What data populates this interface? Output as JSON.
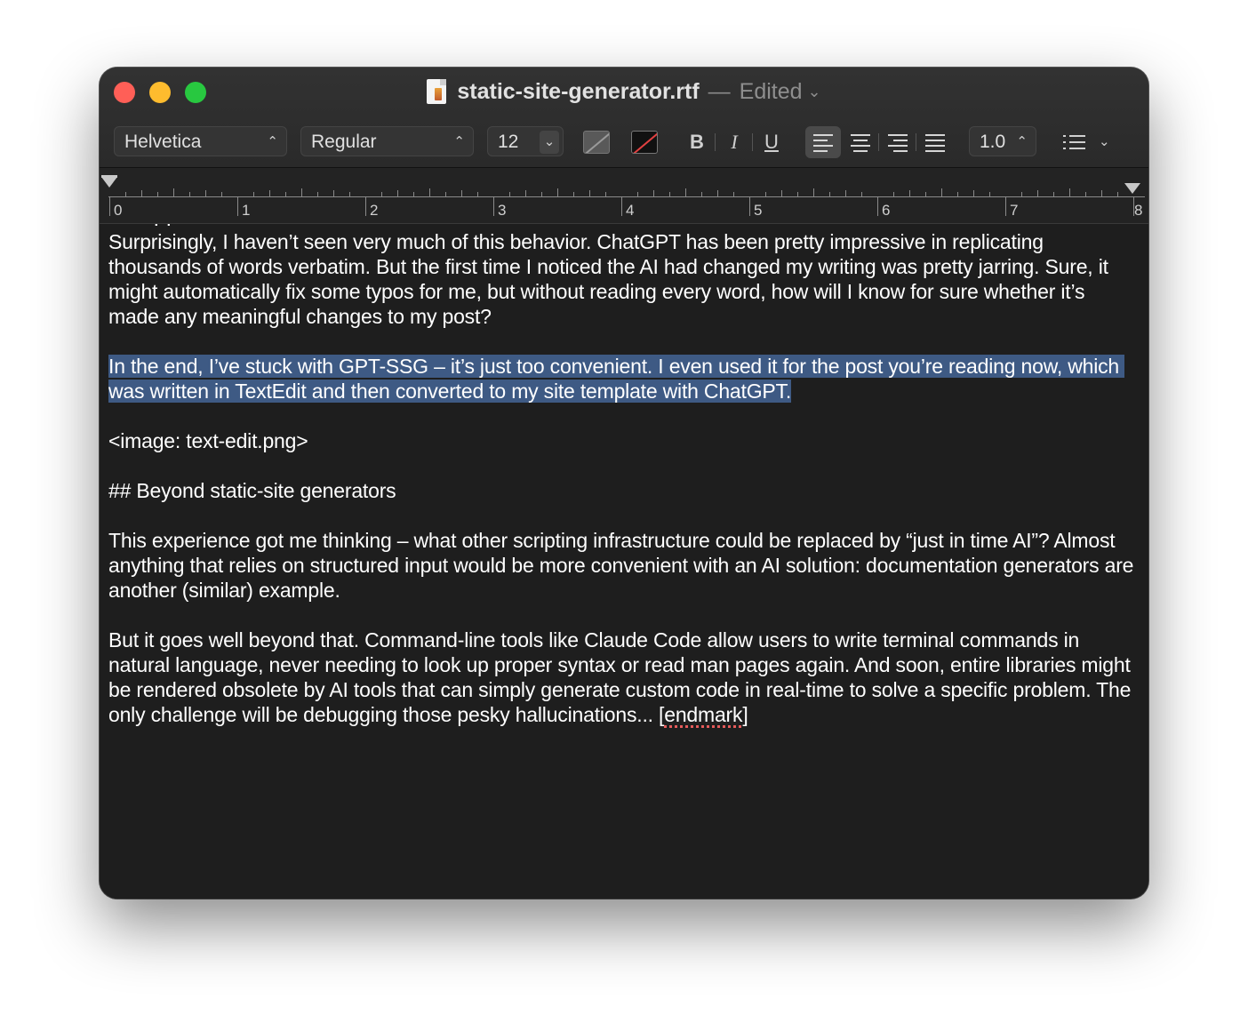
{
  "window": {
    "title": "static-site-generator.rtf",
    "separator": "—",
    "status": "Edited",
    "status_chevron": "⌄"
  },
  "toolbar": {
    "font_family": "Helvetica",
    "font_style": "Regular",
    "font_size": "12",
    "bold_label": "B",
    "italic_label": "I",
    "underline_label": "U",
    "line_spacing": "1.0",
    "updown_glyph": "⌃⌄",
    "chevron_glyph": "⌄"
  },
  "ruler": {
    "labels": [
      "0",
      "1",
      "2",
      "3",
      "4",
      "5",
      "6",
      "7",
      "8"
    ]
  },
  "document": {
    "para1": "Surprisingly, I haven’t seen very much of this behavior. ChatGPT has been pretty impressive in replicating thousands of words verbatim. But the first time I noticed the AI had changed my writing was pretty jarring. Sure, it might automatically fix some typos for me, but without reading every word, how will I know for sure whether it’s made any meaningful changes to my post?",
    "para2_selected": "In the end, I’ve stuck with GPT-SSG – it’s just too convenient. I even used it for the post you’re reading now, which was written in TextEdit and then converted to my site template with ChatGPT.",
    "para3": "<image: text-edit.png>",
    "para4": "## Beyond static-site generators",
    "para5": "This experience got me thinking – what other scripting infrastructure could be replaced by “just in time AI”? Almost anything that relies on structured input would be more convenient with an AI solution: documentation generators are another (similar) example.",
    "para6_main": "But it goes well beyond that. Command-line tools like Claude Code allow users to write terminal commands in natural language, never needing to look up proper syntax or read man pages again. And soon, entire libraries might be rendered obsolete by AI tools that can simply generate custom code in real-time to solve a specific problem. The only challenge will be debugging those pesky hallucinations... [",
    "para6_misspelled": "endmark",
    "para6_end": "]"
  },
  "colors": {
    "selection": "#3e5a84",
    "close": "#ff5f57",
    "minimize": "#febc2e",
    "maximize": "#28c840"
  }
}
